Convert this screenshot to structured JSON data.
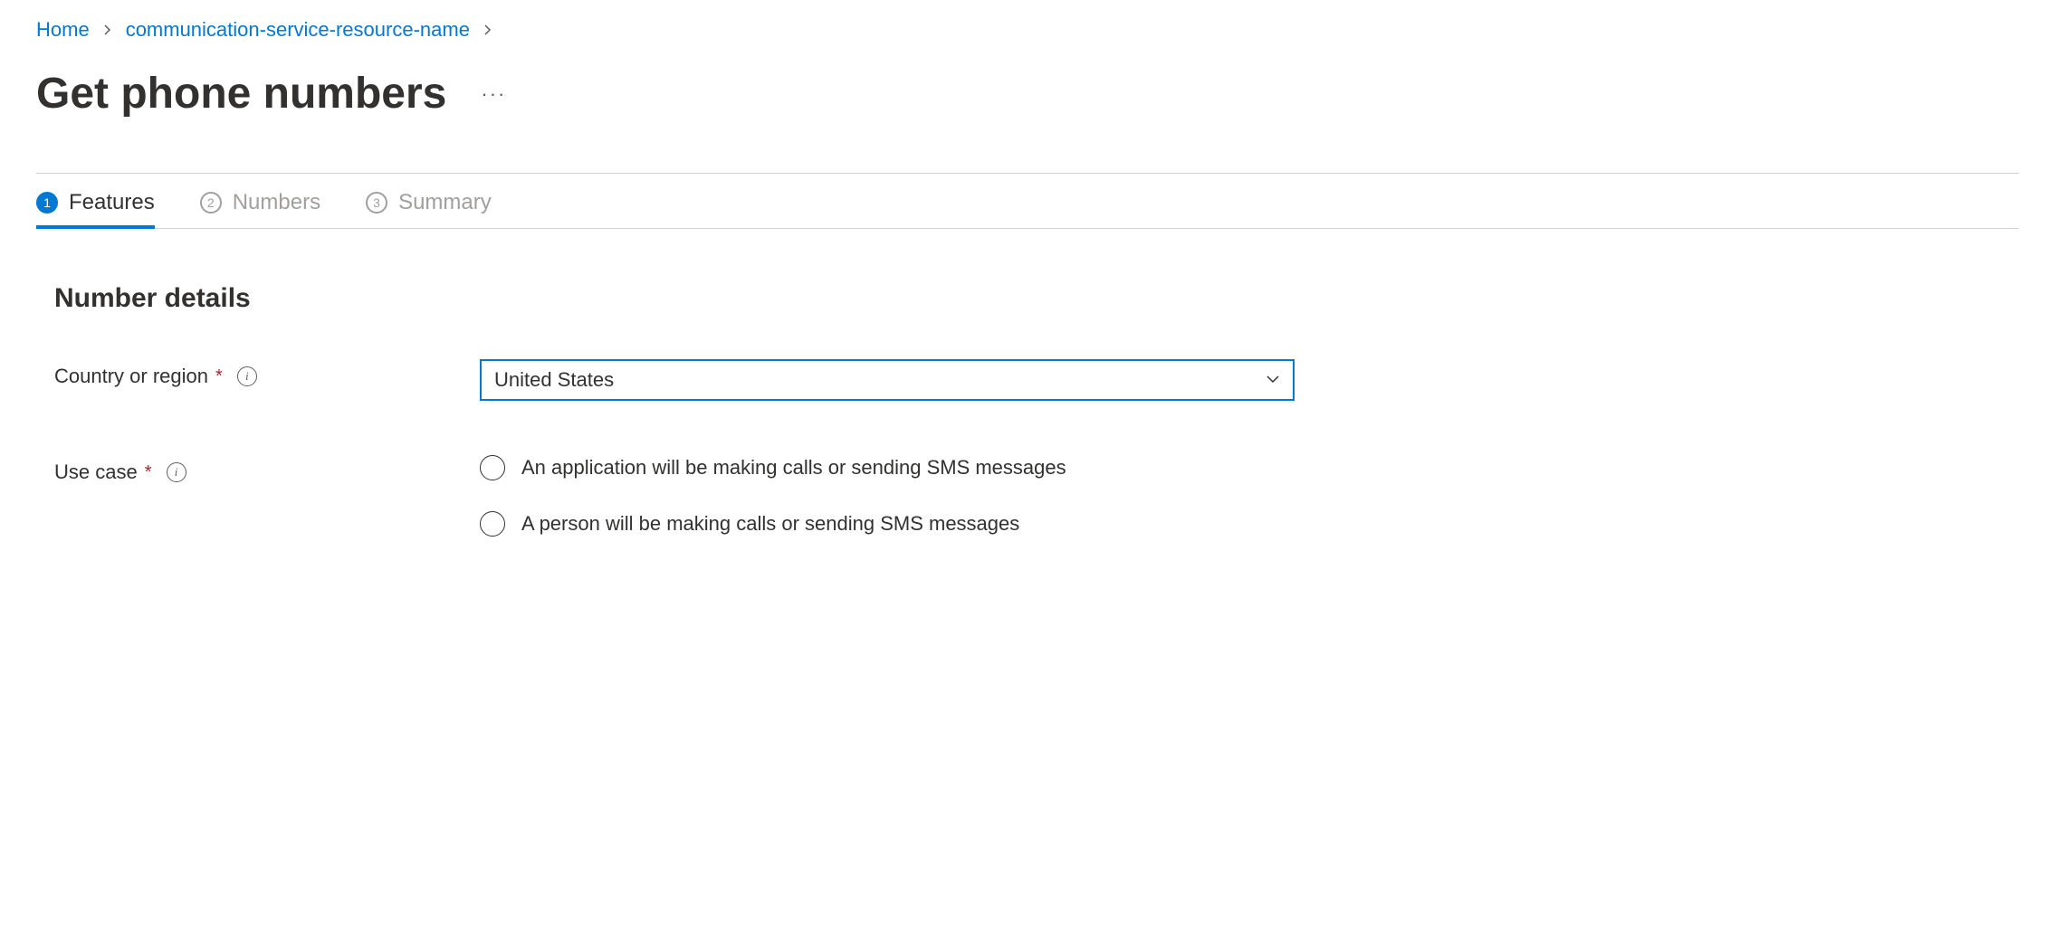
{
  "breadcrumb": {
    "home": "Home",
    "resource": "communication-service-resource-name"
  },
  "page": {
    "title": "Get phone numbers"
  },
  "tabs": [
    {
      "num": "1",
      "label": "Features",
      "active": true
    },
    {
      "num": "2",
      "label": "Numbers",
      "active": false
    },
    {
      "num": "3",
      "label": "Summary",
      "active": false
    }
  ],
  "section": {
    "title": "Number details"
  },
  "form": {
    "country": {
      "label": "Country or region",
      "value": "United States"
    },
    "usecase": {
      "label": "Use case",
      "options": [
        "An application will be making calls or sending SMS messages",
        "A person will be making calls or sending SMS messages"
      ]
    }
  }
}
